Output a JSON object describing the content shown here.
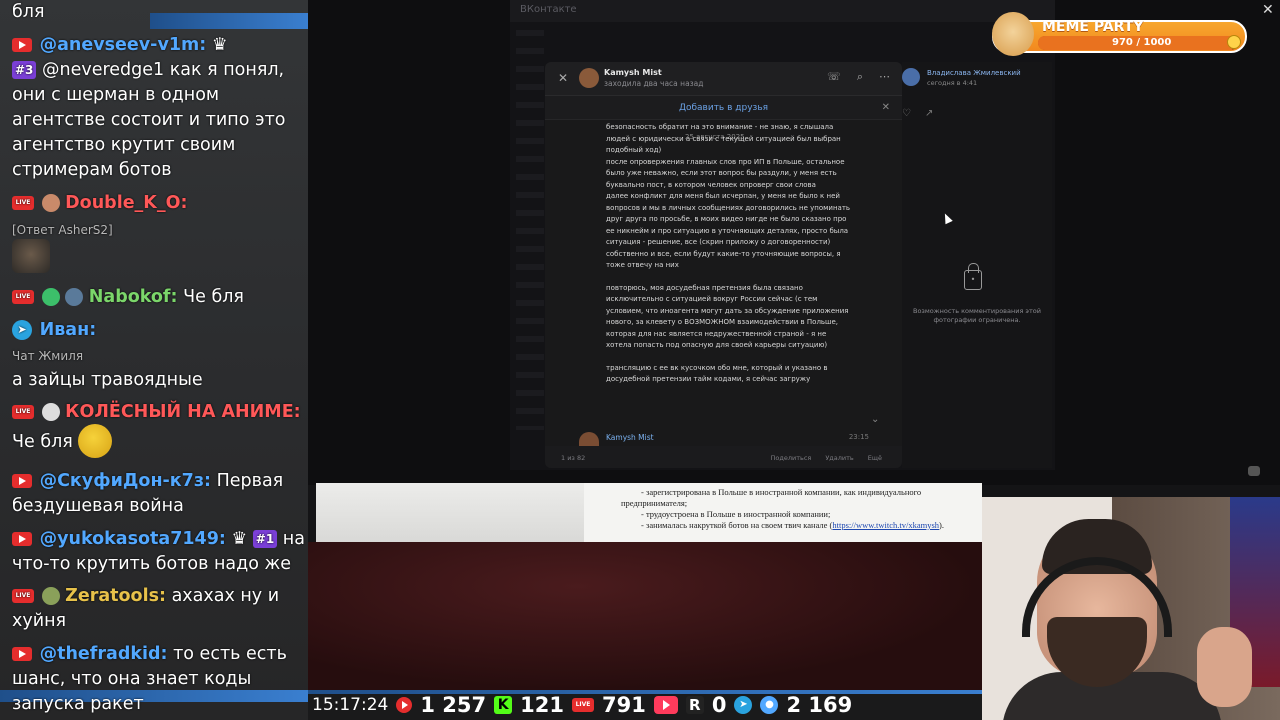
{
  "chat": {
    "messages": [
      {
        "text": "бля"
      },
      {
        "user": "@anevseev-v1m:",
        "badge": "#3",
        "text": "@neveredge1 как я понял, они с шерман в одном агентстве состоит и типо это агентство крутит своим стримерам ботов"
      },
      {
        "user": "Double_K_O:",
        "reply": "[Ответ AsherS2]"
      },
      {
        "user": "Nabokof:",
        "text": "Че бля"
      },
      {
        "user": "Иван:",
        "sub": "Чат Жмиля",
        "text": "а зайцы травоядные"
      },
      {
        "user": "КОЛЁСНЫЙ НА АНИМЕ:",
        "text": "Че бля"
      },
      {
        "user": "@СкуфиДон-к7з:",
        "text": "Первая бездушевая война"
      },
      {
        "user": "@yukokasota7149:",
        "badge": "#1",
        "text": "на что-то крутить ботов надо же"
      },
      {
        "user": "Zeratools:",
        "text": "ахахах ну и хуйня"
      },
      {
        "user": "@thefradkid:",
        "text": "то есть есть шанс, что она знает коды запуска ракет"
      }
    ],
    "m1_l1": "@neveredge1 как я понял,",
    "m1_l2": "они с шерман в одном",
    "m1_l3": "агентстве состоит и типо это",
    "m1_l4": "агентство крутит своим",
    "m1_l5": "стримерам ботов",
    "m6_l1": "Первая",
    "m6_l2": "бездушевая война",
    "m7_l1": "на",
    "m7_l2": "что-то крутить ботов надо же",
    "m8_l1": "ахахах ну и",
    "m8_l2": "хуйня",
    "m9_l1": "то есть есть",
    "m9_l2": "шанс, что она знает коды",
    "m9_l3": "запуска ракет"
  },
  "vk": {
    "top_label": "ВКонтакте",
    "contact_name": "Kamysh Mist",
    "contact_status": "заходила два часа назад",
    "add_friend": "Добавить в друзья",
    "date": "25 августа 2025",
    "body": [
      "безопасность обратит на это внимание - не знаю, я слышала людей с юридически      а связи с текущей ситуацией был выбран подобный ход)",
      "после опровержения главных слов про ИП в Польше, остальное было уже неважно, если этот вопрос бы раздули, у меня есть буквально пост, в котором человек опроверг свои слова",
      "далее конфликт для меня был исчерпан, у меня не было к ней вопросов и мы в личных сообщениях договорились не упоминать друг друга по просьбе, в моих видео нигде не было сказано про ее никнейм и про ситуацию в уточняющих деталях, просто была ситуация - решение, все (скрин приложу о договоренности)",
      "собственно и все, если будут какие-то уточняющие вопросы, я тоже отвечу на них",
      "повторюсь, моя досудебная претензия была связано исключительно с ситуацией вокруг России сейчас (с тем условием, что иноагента могут дать за обсуждение приложения нового, за клевету о ВОЗМОЖНОМ взаимодействии в Польше, которая для нас является недружественной страной - я не хотела попасть под опасную для своей карьеры ситуацию)",
      "трансляцию с ее вк кусочком обо мне, который и указано в досудебной претензии тайм кодами, я сейчас загружу"
    ],
    "msg_name": "Kamysh Mist",
    "msg_time": "23:15",
    "pager": "1 из 82",
    "actions": [
      "Поделиться",
      "Удалить",
      "Ещё"
    ],
    "right_user": "Владислава Жмилевский",
    "right_time": "сегодня в 4:41",
    "locked_note": "Возможность комментирования этой фотографии ограничена."
  },
  "doc": {
    "line1": "- зарегистрирована в Польше в иностранной компании, как индивидуального",
    "line1b": "предпринимателя;",
    "line2": "- трудоустроена в Польше в иностранной компании;",
    "line3": "- занималась накруткой ботов на своем твич канале (",
    "link": "https://www.twitch.tv/xkamysh",
    "line3_end": ")."
  },
  "stats": {
    "time": "15:17:24",
    "youtube": "1 257",
    "kick": "121",
    "vklive": "791",
    "rutube_play": "",
    "r": "0",
    "total_viewers": "2 169"
  },
  "meme_party": {
    "title": "MEME PARTY",
    "progress": "970 / 1000",
    "fraction": 0.97
  }
}
